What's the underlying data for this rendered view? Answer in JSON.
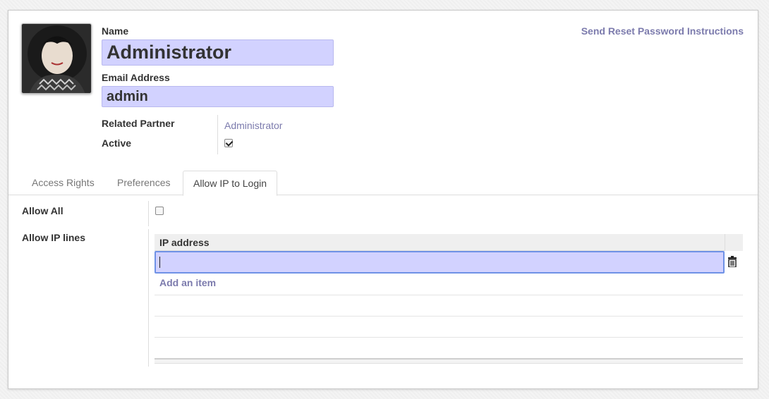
{
  "header": {
    "reset_password_link": "Send Reset Password Instructions"
  },
  "form": {
    "name_label": "Name",
    "name_value": "Administrator",
    "email_label": "Email Address",
    "email_value": "admin",
    "related_partner_label": "Related Partner",
    "related_partner_value": "Administrator",
    "active_label": "Active",
    "active_checked": true
  },
  "tabs": [
    {
      "label": "Access Rights",
      "active": false
    },
    {
      "label": "Preferences",
      "active": false
    },
    {
      "label": "Allow IP to Login",
      "active": true
    }
  ],
  "allow_ip_tab": {
    "allow_all_label": "Allow All",
    "allow_all_checked": false,
    "allow_ip_lines_label": "Allow IP lines",
    "table_column_header": "IP address",
    "current_input_value": "",
    "add_item_label": "Add an item"
  },
  "colors": {
    "field_background": "#d2d2ff",
    "link_color": "#7c7bad",
    "focus_border": "#6f92e6"
  }
}
